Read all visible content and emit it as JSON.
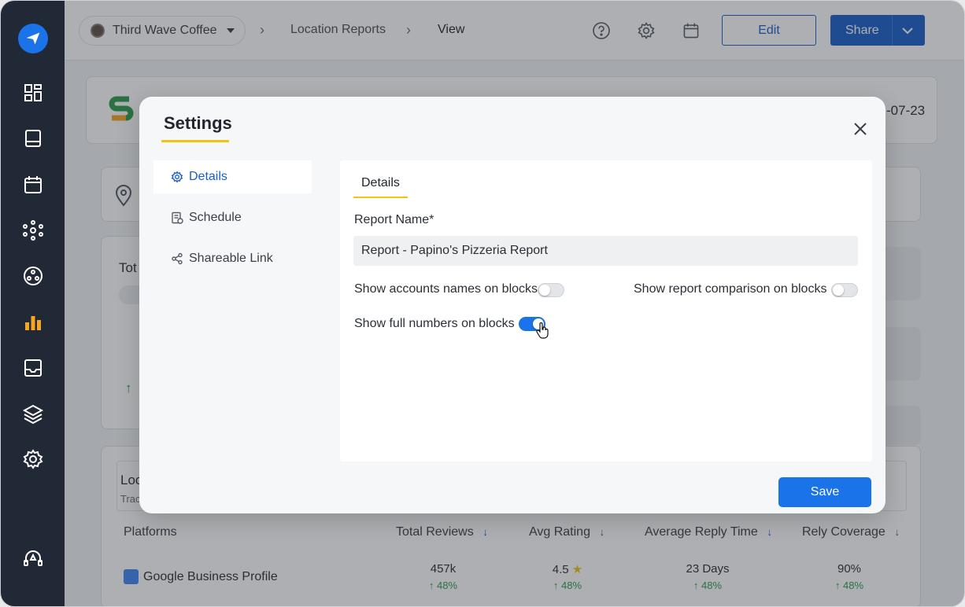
{
  "topbar": {
    "brand_name": "Third Wave Coffee",
    "breadcrumb": [
      "Location Reports",
      "View"
    ],
    "edit_label": "Edit",
    "share_label": "Share"
  },
  "background": {
    "date_fragment": "-07-23",
    "card_fragment_1": "Tot",
    "card_fragment_2": "Loc",
    "card_fragment_3": "Trac",
    "table": {
      "headers": [
        "Platforms",
        "Total Reviews",
        "Avg Rating",
        "Average Reply Time",
        "Rely Coverage"
      ],
      "row": {
        "platform": "Google Business Profile",
        "total_reviews": "457k",
        "avg_rating": "4.5",
        "avg_reply_time": "23 Days",
        "coverage": "90%",
        "change": "48%"
      }
    }
  },
  "modal": {
    "title": "Settings",
    "nav": [
      {
        "label": "Details",
        "icon": "gear-icon"
      },
      {
        "label": "Schedule",
        "icon": "schedule-icon"
      },
      {
        "label": "Shareable Link",
        "icon": "share-icon"
      }
    ],
    "panel_tab": "Details",
    "report_name_label": "Report Name*",
    "report_name_value": "Report - Papino's Pizzeria Report",
    "toggles": {
      "account_names": {
        "label": "Show accounts names on blocks",
        "on": false
      },
      "report_comparison": {
        "label": "Show report comparison on blocks",
        "on": false
      },
      "full_numbers": {
        "label": "Show full numbers on blocks",
        "on": true
      }
    },
    "save_label": "Save"
  },
  "colors": {
    "accent": "#1a73e8",
    "sidebar": "#222936",
    "highlight": "#f2c40f",
    "positive": "#2e9c4b"
  }
}
